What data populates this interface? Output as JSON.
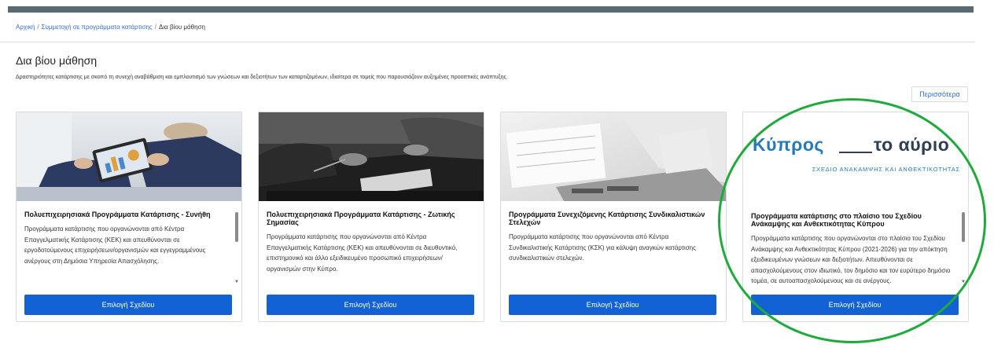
{
  "breadcrumb": {
    "home": "Αρχική",
    "section": "Συμμετοχή σε προγράμματα κατάρτισης",
    "current": "Δια βίου μάθηση"
  },
  "page": {
    "title": "Δια βίου μάθηση",
    "description": "Δραστηριότητες κατάρτισης με σκοπό τη συνεχή αναβάθμιση και εμπλουτισμό των γνώσεων και δεξιοτήτων των καταρτιζομένων, ιδιαίτερα σε τομείς που παρουσιάζουν αυξημένες προοπτικές ανάπτυξης.",
    "more_label": "Περισσότερα"
  },
  "cards": [
    {
      "title": "Πολυεπιχειρησιακά Προγράμματα Κατάρτισης - Συνήθη",
      "text": "Προγράμματα κατάρτισης που οργανώνονται από Κέντρα Επαγγελματικής Κατάρτισης (ΚΕΚ) και απευθύνονται σε εργοδοτούμενους επιχειρήσεων/οργανισμών και εγγεγραμμένους ανέργους στη Δημόσια Υπηρεσία Απασχόλησης.",
      "button": "Επιλογή Σχεδίου"
    },
    {
      "title": "Πολυεπιχειρησιακά Προγράμματα Κατάρτισης - Ζωτικής Σημασίας",
      "text": "Προγράμματα κατάρτισης που οργανώνονται από Κέντρα Επαγγελματικής Κατάρτισης (ΚΕΚ) και απευθύνονται σε διευθυντικό, επιστημονικό και άλλο εξειδικευμένο προσωπικό επιχειρήσεων/οργανισμών στην Κύπρο.",
      "button": "Επιλογή Σχεδίου"
    },
    {
      "title": "Προγράμματα Συνεχιζόμενης Κατάρτισης Συνδικαλιστικών Στελεχών",
      "text": "Προγράμματα κατάρτισης που οργανώνονται από Κέντρα Συνδικαλιστικής Κατάρτισης (ΚΣΚ) για κάλυψη αναγκών κατάρτισης συνδικαλιστικών στελεχών.",
      "button": "Επιλογή Σχεδίου"
    },
    {
      "title": "Προγράμματα κατάρτισης στο πλαίσιο του Σχεδίου Ανάκαμψης και Ανθεκτικότητας Κύπρου",
      "text": "Προγράμματα κατάρτισης που οργανώνονται στο πλαίσιο του Σχεδίου Ανάκαμψης και Ανθεκτικότητας Κύπρου (2021-2026) για την απόκτηση εξειδικευμένων γνώσεων και δεξιοτήτων. Απευθύνονται σε απασχολούμενους στον ιδιωτικό, τον δημόσιο και τον ευρύτερο δημόσιο τομέα, σε αυτοαπασχολούμενους και σε ανέργους.",
      "button": "Επιλογή Σχεδίου",
      "logo_main": "Κύπρος",
      "logo_main2": "το αύριο",
      "logo_sub": "ΣΧΕΔΙΟ ΑΝΑΚΑΜΨΗΣ ΚΑΙ ΑΝΘΕΚΤΙΚΟΤΗΤΑΣ"
    }
  ],
  "colors": {
    "topbar": "#596a72",
    "link": "#2f6fd0",
    "button": "#1262d6",
    "highlight": "#1faa3c",
    "logo_blue": "#2779b8",
    "logo_navy": "#2f3f58"
  }
}
